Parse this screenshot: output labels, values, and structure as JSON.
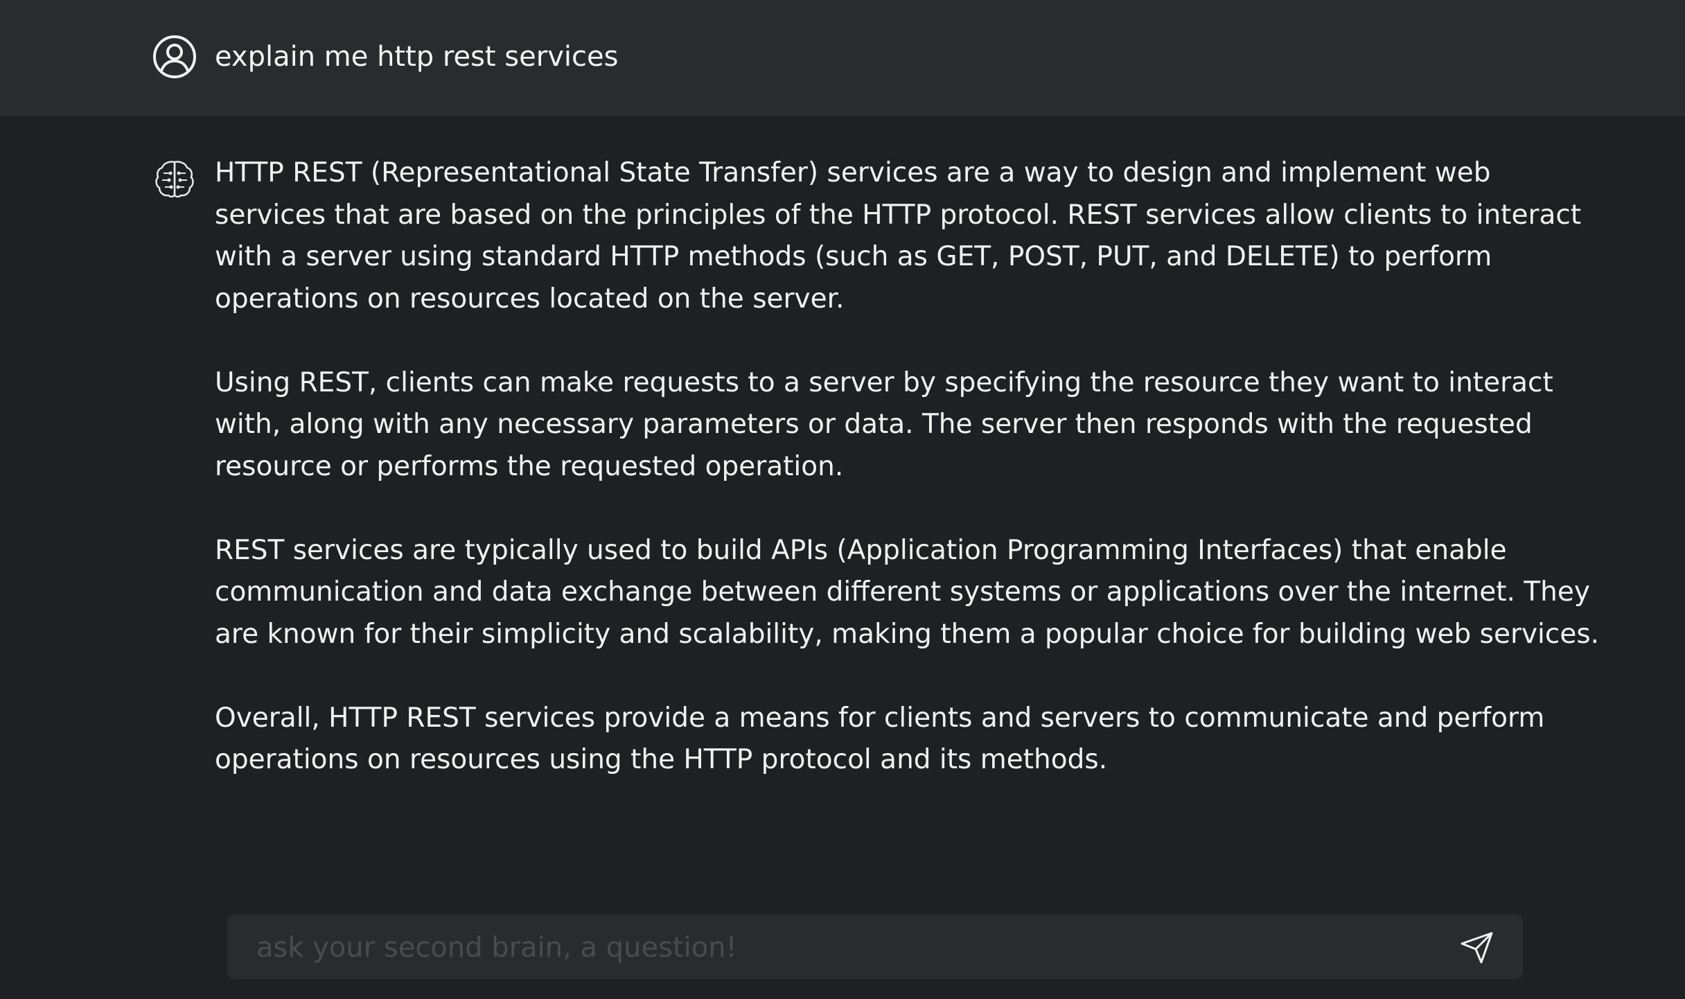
{
  "user_message": {
    "icon": "user-circle-icon",
    "text": "explain me http rest services"
  },
  "assistant_message": {
    "icon": "brain-icon",
    "paragraphs": [
      "HTTP REST (Representational State Transfer) services are a way to design and implement web services that are based on the principles of the HTTP protocol. REST services allow clients to interact with a server using standard HTTP methods (such as GET, POST, PUT, and DELETE) to perform operations on resources located on the server.",
      "Using REST, clients can make requests to a server by specifying the resource they want to interact with, along with any necessary parameters or data. The server then responds with the requested resource or performs the requested operation.",
      "REST services are typically used to build APIs (Application Programming Interfaces) that enable communication and data exchange between different systems or applications over the internet. They are known for their simplicity and scalability, making them a popular choice for building web services.",
      "Overall, HTTP REST services provide a means for clients and servers to communicate and perform operations on resources using the HTTP protocol and its methods."
    ]
  },
  "composer": {
    "placeholder": "ask your second brain, a question!",
    "value": "",
    "send_icon": "send-paper-plane-icon"
  },
  "colors": {
    "background": "#1f2023",
    "user_row": "#2a2b2e",
    "text": "#f1f1f1",
    "placeholder": "#4a4b4f"
  }
}
